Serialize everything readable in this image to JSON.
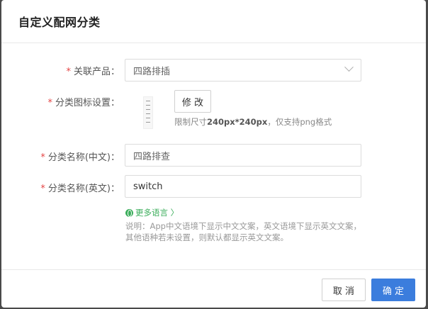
{
  "dialog": {
    "title": "自定义配网分类",
    "fields": {
      "product": {
        "label": "关联产品：",
        "value": "四路排插",
        "required_mark": "*"
      },
      "icon": {
        "label": "分类图标设置：",
        "required_mark": "*",
        "modify_label": "修 改",
        "hint_prefix": "限制尺寸",
        "hint_size": "240px*240px",
        "hint_suffix": "，仅支持png格式"
      },
      "name_cn": {
        "label": "分类名称(中文)：",
        "required_mark": "*",
        "placeholder": "四路排查"
      },
      "name_en": {
        "label": "分类名称(英文)：",
        "required_mark": "*",
        "value": "switch"
      }
    },
    "more_languages": "更多语言 〉",
    "description": "说明：App中文语境下显示中文文案，英文语境下显示英文文案，其他语种若未设置，则默认都显示英文文案。",
    "footer": {
      "cancel_label": "取 消",
      "ok_label": "确 定"
    }
  },
  "colors": {
    "primary": "#3b7ddd",
    "link_green": "#3cae5c",
    "required": "#e54545"
  }
}
